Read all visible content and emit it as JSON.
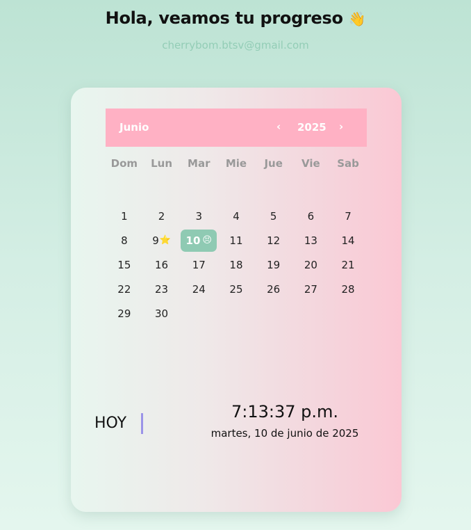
{
  "header": {
    "title": "Hola, veamos tu progreso",
    "title_emoji": "👋",
    "email": "cherrybom.btsv@gmail.com"
  },
  "calendar": {
    "month": "Junio",
    "year": "2025",
    "prev_label": "‹",
    "next_label": "›",
    "weekdays": [
      "Dom",
      "Lun",
      "Mar",
      "Mie",
      "Jue",
      "Vie",
      "Sab"
    ],
    "weeks": [
      [
        "1",
        "2",
        "3",
        "4",
        "5",
        "6",
        "7"
      ],
      [
        "8",
        "9",
        "10",
        "11",
        "12",
        "13",
        "14"
      ],
      [
        "15",
        "16",
        "17",
        "18",
        "19",
        "20",
        "21"
      ],
      [
        "22",
        "23",
        "24",
        "25",
        "26",
        "27",
        "28"
      ],
      [
        "29",
        "30",
        "",
        "",
        "",
        "",
        ""
      ]
    ],
    "marks": {
      "9": "⭐",
      "10": "😣"
    },
    "selected_day": "10"
  },
  "today_panel": {
    "label": "HOY",
    "time": "7:13:37 p.m.",
    "date": "martes, 10 de junio de 2025"
  },
  "colors": {
    "header_bg": "#ffb1c4",
    "selected_bg": "#8fcab3",
    "divider": "#9a94e8",
    "email": "#93cdb6"
  }
}
